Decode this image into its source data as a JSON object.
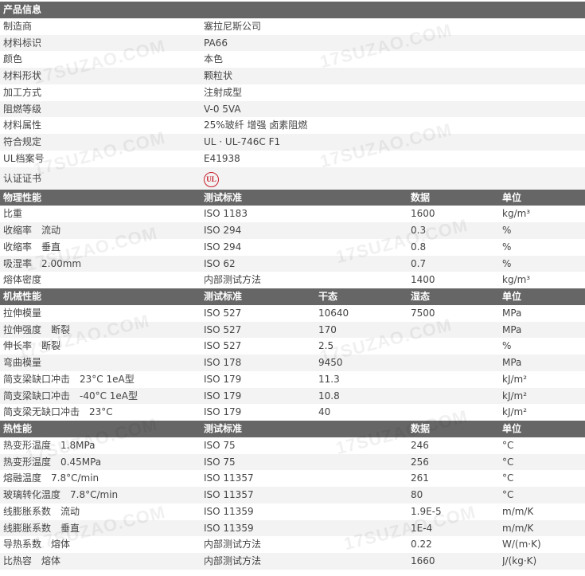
{
  "watermark": "17SUZAO.COM",
  "sections": [
    {
      "title": "产品信息",
      "headers": [],
      "rows": [
        [
          "制造商",
          "塞拉尼斯公司"
        ],
        [
          "材料标识",
          "PA66"
        ],
        [
          "颜色",
          "本色"
        ],
        [
          "材料形状",
          "颗粒状"
        ],
        [
          "加工方式",
          "注射成型"
        ],
        [
          "阻燃等级",
          "V-0 5VA"
        ],
        [
          "材料属性",
          "25%玻纤 增强 卤素阻燃"
        ],
        [
          "符合规定",
          "UL · UL-746C F1"
        ],
        [
          "UL档案号",
          "E41938"
        ],
        [
          "认证证书",
          "UL"
        ]
      ]
    },
    {
      "title": "物理性能",
      "headers": [
        "测试标准",
        "",
        "数据",
        "单位"
      ],
      "rows": [
        [
          "比重",
          "ISO 1183",
          "",
          "1600",
          "kg/m³"
        ],
        [
          "收缩率　流动",
          "ISO 294",
          "",
          "0.3",
          "%"
        ],
        [
          "收缩率　垂直",
          "ISO 294",
          "",
          "0.8",
          "%"
        ],
        [
          "吸湿率　2.00mm",
          "ISO 62",
          "",
          "0.7",
          "%"
        ],
        [
          "熔体密度",
          "内部测试方法",
          "",
          "1400",
          "kg/m³"
        ]
      ]
    },
    {
      "title": "机械性能",
      "headers": [
        "测试标准",
        "干态",
        "湿态",
        "单位"
      ],
      "rows": [
        [
          "拉伸模量",
          "ISO 527",
          "10640",
          "7500",
          "MPa"
        ],
        [
          "拉伸强度　断裂",
          "ISO 527",
          "170",
          "",
          "MPa"
        ],
        [
          "伸长率　断裂",
          "ISO 527",
          "2.5",
          "",
          "%"
        ],
        [
          "弯曲模量",
          "ISO 178",
          "9450",
          "",
          "MPa"
        ],
        [
          "简支梁缺口冲击　23°C 1eA型",
          "ISO 179",
          "11.3",
          "",
          "kJ/m²"
        ],
        [
          "简支梁缺口冲击　-40°C 1eA型",
          "ISO 179",
          "10.8",
          "",
          "kJ/m²"
        ],
        [
          "简支梁无缺口冲击　23°C",
          "ISO 179",
          "40",
          "",
          "kJ/m²"
        ]
      ]
    },
    {
      "title": "热性能",
      "headers": [
        "测试标准",
        "",
        "数据",
        "单位"
      ],
      "rows": [
        [
          "热变形温度　1.8MPa",
          "ISO 75",
          "",
          "246",
          "°C"
        ],
        [
          "热变形温度　0.45MPa",
          "ISO 75",
          "",
          "256",
          "°C"
        ],
        [
          "熔融温度　7.8°C/min",
          "ISO 11357",
          "",
          "261",
          "°C"
        ],
        [
          "玻璃转化温度　7.8°C/min",
          "ISO 11357",
          "",
          "80",
          "°C"
        ],
        [
          "线膨胀系数　流动",
          "ISO 11359",
          "",
          "1.9E-5",
          "m/m/K"
        ],
        [
          "线膨胀系数　垂直",
          "ISO 11359",
          "",
          "1E-4",
          "m/m/K"
        ],
        [
          "导热系数　熔体",
          "内部测试方法",
          "",
          "0.22",
          "W/(m·K)"
        ],
        [
          "比热容　熔体",
          "内部测试方法",
          "",
          "1660",
          "J/(kg·K)"
        ]
      ]
    }
  ]
}
